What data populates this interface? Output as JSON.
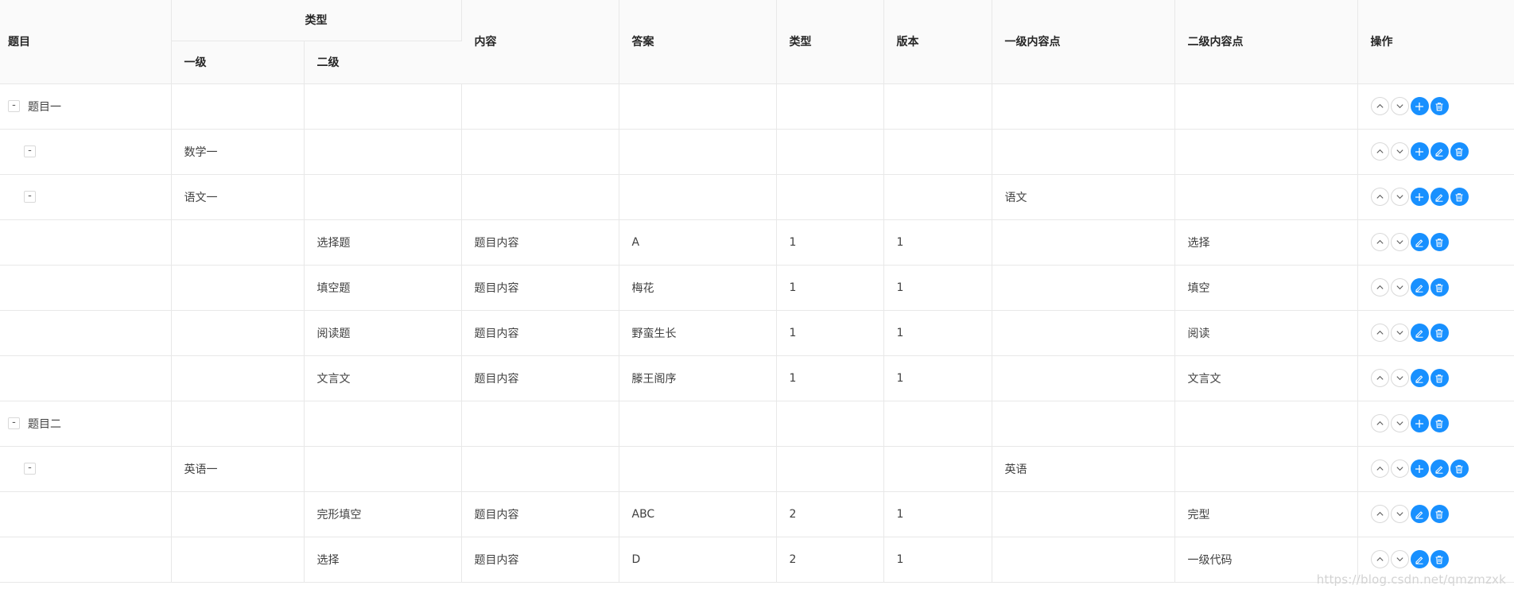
{
  "table": {
    "headers": {
      "title": "题目",
      "category_group": "类型",
      "level1": "一级",
      "level2": "二级",
      "content": "内容",
      "answer": "答案",
      "type": "类型",
      "version": "版本",
      "point1": "一级内容点",
      "point2": "二级内容点",
      "ops": "操作"
    },
    "expander_symbol": "-",
    "rows": [
      {
        "level": 0,
        "title": "题目一",
        "cat1": "",
        "cat2": "",
        "content": "",
        "answer": "",
        "type": "",
        "version": "",
        "point1": "",
        "point2": "",
        "ops": [
          "up",
          "down",
          "add",
          "delete"
        ]
      },
      {
        "level": 1,
        "title": "",
        "cat1": "数学一",
        "cat2": "",
        "content": "",
        "answer": "",
        "type": "",
        "version": "",
        "point1": "",
        "point2": "",
        "ops": [
          "up",
          "down",
          "add",
          "edit",
          "delete"
        ]
      },
      {
        "level": 1,
        "title": "",
        "cat1": "语文一",
        "cat2": "",
        "content": "",
        "answer": "",
        "type": "",
        "version": "",
        "point1": "语文",
        "point2": "",
        "ops": [
          "up",
          "down",
          "add",
          "edit",
          "delete"
        ]
      },
      {
        "level": 2,
        "title": "",
        "cat1": "",
        "cat2": "选择题",
        "content": "题目内容",
        "answer": "A",
        "type": "1",
        "version": "1",
        "point1": "",
        "point2": "选择",
        "ops": [
          "up",
          "down",
          "edit",
          "delete"
        ]
      },
      {
        "level": 2,
        "title": "",
        "cat1": "",
        "cat2": "填空题",
        "content": "题目内容",
        "answer": "梅花",
        "type": "1",
        "version": "1",
        "point1": "",
        "point2": "填空",
        "ops": [
          "up",
          "down",
          "edit",
          "delete"
        ]
      },
      {
        "level": 2,
        "title": "",
        "cat1": "",
        "cat2": "阅读题",
        "content": "题目内容",
        "answer": "野蛮生长",
        "type": "1",
        "version": "1",
        "point1": "",
        "point2": "阅读",
        "ops": [
          "up",
          "down",
          "edit",
          "delete"
        ]
      },
      {
        "level": 2,
        "title": "",
        "cat1": "",
        "cat2": "文言文",
        "content": "题目内容",
        "answer": "滕王阁序",
        "type": "1",
        "version": "1",
        "point1": "",
        "point2": "文言文",
        "ops": [
          "up",
          "down",
          "edit",
          "delete"
        ]
      },
      {
        "level": 0,
        "title": "题目二",
        "cat1": "",
        "cat2": "",
        "content": "",
        "answer": "",
        "type": "",
        "version": "",
        "point1": "",
        "point2": "",
        "ops": [
          "up",
          "down",
          "add",
          "delete"
        ]
      },
      {
        "level": 1,
        "title": "",
        "cat1": "英语一",
        "cat2": "",
        "content": "",
        "answer": "",
        "type": "",
        "version": "",
        "point1": "英语",
        "point2": "",
        "ops": [
          "up",
          "down",
          "add",
          "edit",
          "delete"
        ]
      },
      {
        "level": 2,
        "title": "",
        "cat1": "",
        "cat2": "完形填空",
        "content": "题目内容",
        "answer": "ABC",
        "type": "2",
        "version": "1",
        "point1": "",
        "point2": "完型",
        "ops": [
          "up",
          "down",
          "edit",
          "delete"
        ]
      },
      {
        "level": 2,
        "title": "",
        "cat1": "",
        "cat2": "选择",
        "content": "题目内容",
        "answer": "D",
        "type": "2",
        "version": "1",
        "point1": "",
        "point2": "一级代码",
        "ops": [
          "up",
          "down",
          "edit",
          "delete"
        ]
      }
    ]
  },
  "colors": {
    "primary": "#1890ff",
    "header_bg": "#fafafa",
    "border": "#e8e8e8"
  },
  "watermark": "https://blog.csdn.net/qmzmzxk"
}
